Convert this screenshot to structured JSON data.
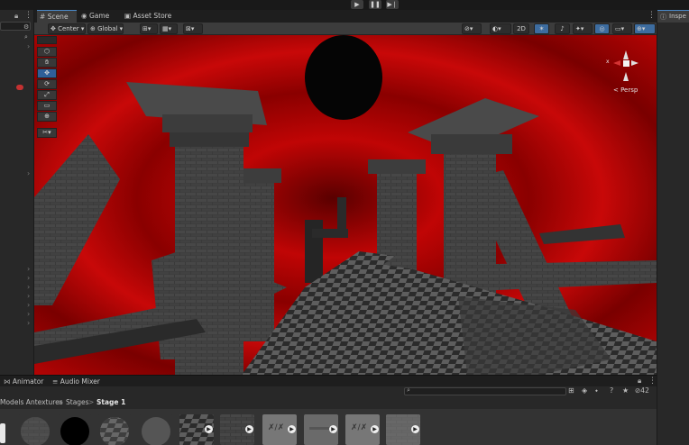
{
  "tabs": {
    "scene": "Scene",
    "game": "Game",
    "asset_store": "Asset Store"
  },
  "scene_toolbar": {
    "pivot": "Center",
    "space": "Global",
    "mode_2d": "2D"
  },
  "gizmo": {
    "projection": "< Persp",
    "x_axis": "x"
  },
  "inspector": {
    "tab": "Inspe"
  },
  "bottom": {
    "tab_animator": "Animator",
    "tab_audio_mixer": "Audio Mixer",
    "hidden_count": "42",
    "breadcrumb": {
      "root": "Models Antextures",
      "sep1": ">",
      "folder": "Stages",
      "sep2": ">",
      "current": "Stage 1"
    }
  },
  "colors": {
    "accent": "#3d6c9f",
    "sky": "#b00000"
  }
}
